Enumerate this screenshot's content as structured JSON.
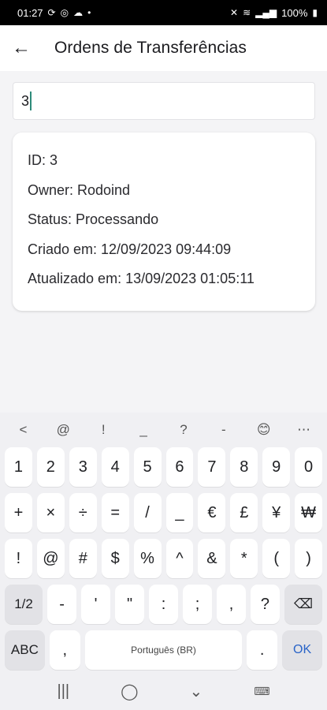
{
  "status_bar": {
    "time": "01:27",
    "left_icons": [
      "sync-icon",
      "spinner-icon",
      "cloud-icon",
      "dot-icon"
    ],
    "battery": "100%"
  },
  "app_bar": {
    "title": "Ordens de Transferências"
  },
  "search": {
    "value": "3"
  },
  "card": {
    "id": "ID: 3",
    "owner": "Owner: Rodoind",
    "status": "Status: Processando",
    "created": "Criado em: 12/09/2023 09:44:09",
    "updated": "Atualizado em: 13/09/2023 01:05:11"
  },
  "keyboard": {
    "toolbar": [
      "<",
      "@",
      "!",
      "_",
      "?",
      "-",
      "emoji",
      "..."
    ],
    "rows": [
      [
        "1",
        "2",
        "3",
        "4",
        "5",
        "6",
        "7",
        "8",
        "9",
        "0"
      ],
      [
        "+",
        "×",
        "÷",
        "=",
        "/",
        "_",
        "€",
        "£",
        "¥",
        "₩"
      ],
      [
        "!",
        "@",
        "#",
        "$",
        "%",
        "^",
        "&",
        "*",
        "(",
        ")"
      ],
      [
        "1/2",
        "-",
        "'",
        "\"",
        ":",
        ";",
        ",",
        "?",
        "backspace"
      ]
    ],
    "bottom": {
      "abc": "ABC",
      "comma": ",",
      "space": "Português (BR)",
      "period": ".",
      "ok": "OK"
    }
  }
}
